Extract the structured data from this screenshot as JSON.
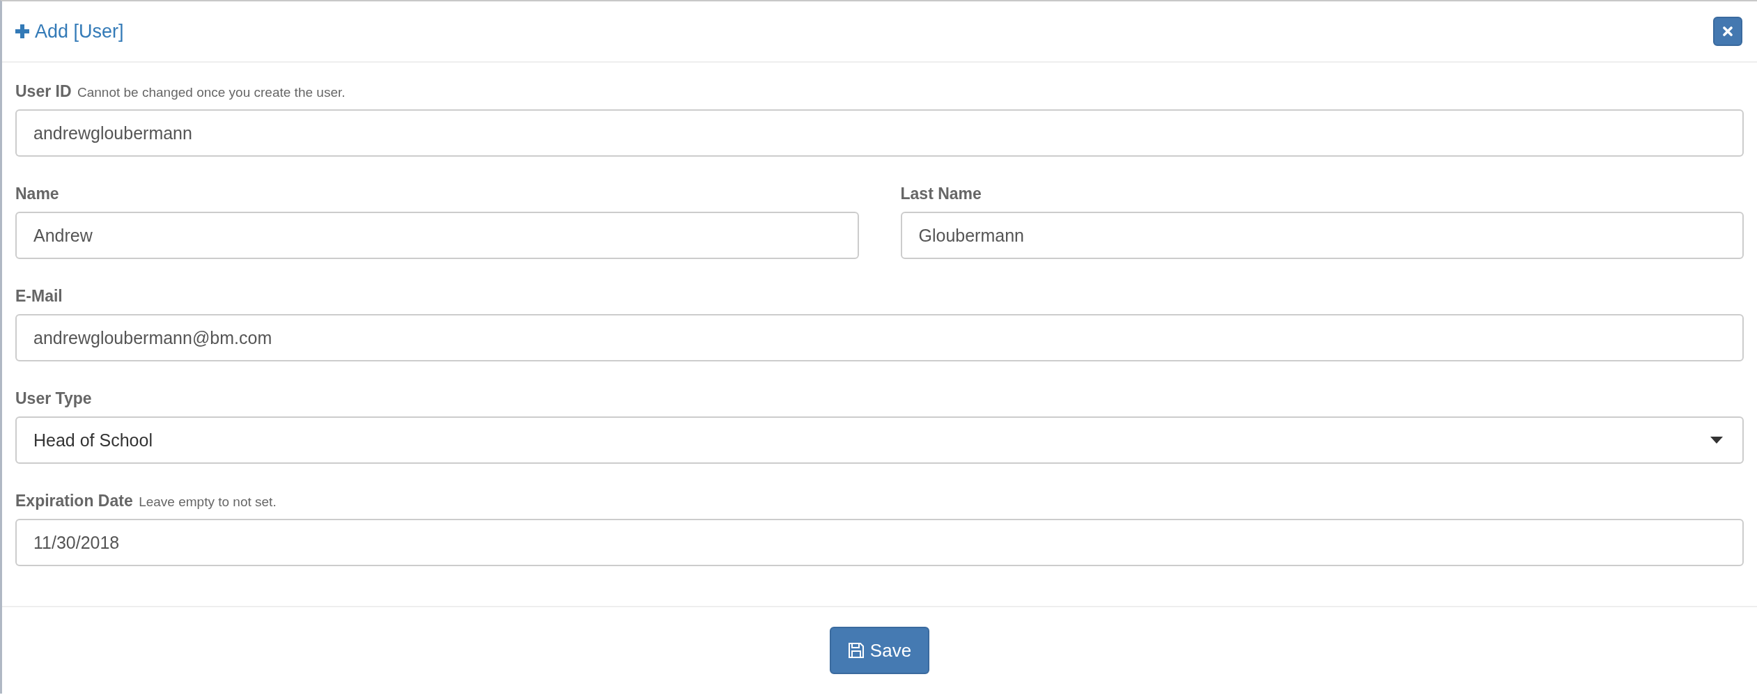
{
  "dialog": {
    "title": "Add [User]"
  },
  "rows": [
    [
      {
        "kind": "text",
        "label": "User ID",
        "hint": "Cannot be changed once you create the user.",
        "value": "andrewgloubermann"
      }
    ],
    [
      {
        "kind": "text",
        "label": "Name",
        "value": "Andrew"
      },
      {
        "kind": "text",
        "label": "Last Name",
        "value": "Gloubermann"
      }
    ],
    [
      {
        "kind": "text",
        "label": "E-Mail",
        "value": "andrewgloubermann@bm.com"
      }
    ],
    [
      {
        "kind": "select",
        "label": "User Type",
        "value": "Head of School"
      }
    ],
    [
      {
        "kind": "text",
        "label": "Expiration Date",
        "hint": "Leave empty to not set.",
        "value": "11/30/2018"
      }
    ]
  ],
  "save_button": "Save"
}
